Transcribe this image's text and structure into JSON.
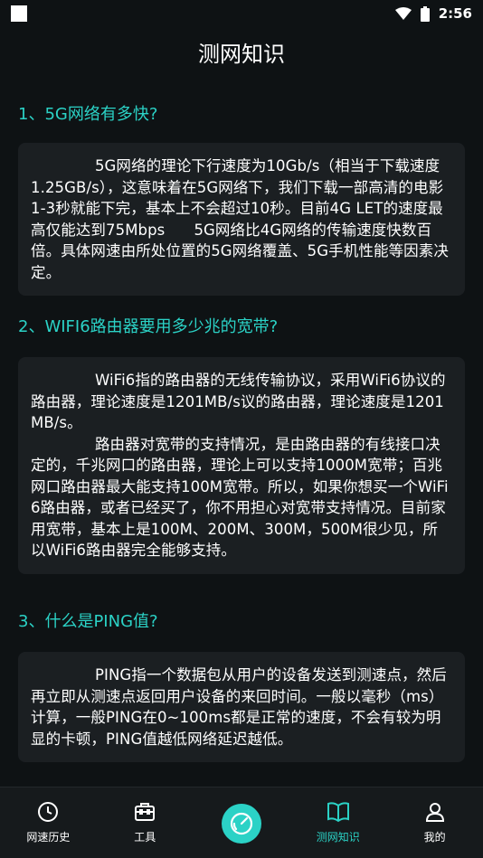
{
  "status_bar": {
    "time": "2:56"
  },
  "title": "测网知识",
  "sections": [
    {
      "heading": "1、5G网络有多快?",
      "paragraphs": [
        "5G网络的理论下行速度为10Gb/s（相当于下载速度1.25GB/s），这意味着在5G网络下，我们下载一部高清的电影1-3秒就能下完，基本上不会超过10秒。目前4G LET的速度最高仅能达到75Mbps      5G网络比4G网络的传输速度快数百倍。具体网速由所处位置的5G网络覆盖、5G手机性能等因素决定。"
      ]
    },
    {
      "heading": "2、WIFI6路由器要用多少兆的宽带?",
      "paragraphs": [
        "WiFi6指的路由器的无线传输协议，采用WiFi6协议的路由器，理论速度是1201MB/s议的路由器，理论速度是1201MB/s。",
        "路由器对宽带的支持情况，是由路由器的有线接口决定的，千兆网口的路由器，理论上可以支持1000M宽带；百兆网口路由器最大能支持100M宽带。所以，如果你想买一个WiFi6路由器，或者已经买了，你不用担心对宽带支持情况。目前家用宽带，基本上是100M、200M、300M，500M很少见，所以WiFi6路由器完全能够支持。"
      ]
    },
    {
      "heading": "3、什么是PING值?",
      "paragraphs": [
        "PING指一个数据包从用户的设备发送到测速点，然后再立即从测速点返回用户设备的来回时间。一般以毫秒（ms）计算，一般PING在0~100ms都是正常的速度，不会有较为明显的卡顿，PING值越低网络延迟越低。"
      ]
    }
  ],
  "nav": {
    "history": "网速历史",
    "tools": "工具",
    "knowledge": "测网知识",
    "mine": "我的"
  },
  "colors": {
    "accent": "#2bd2c6",
    "background": "#0e1214",
    "card": "#1b1f22"
  }
}
